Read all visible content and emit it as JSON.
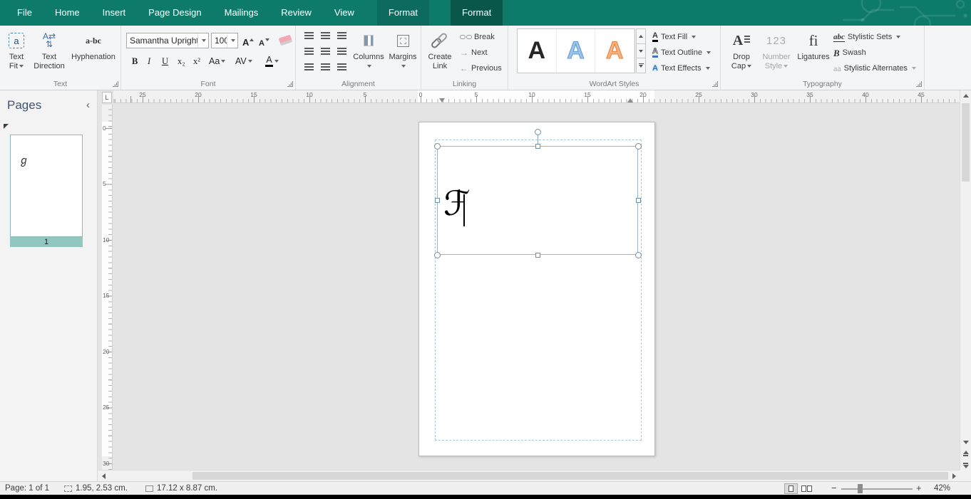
{
  "titlebar": {
    "tabs": [
      {
        "label": "File"
      },
      {
        "label": "Home"
      },
      {
        "label": "Insert"
      },
      {
        "label": "Page Design"
      },
      {
        "label": "Mailings"
      },
      {
        "label": "Review"
      },
      {
        "label": "View"
      },
      {
        "label": "Format"
      },
      {
        "label": "Format"
      }
    ]
  },
  "ribbon": {
    "text": {
      "group_label": "Text",
      "text_fit": "Text Fit",
      "text_fit_icon": "a",
      "text_direction": "Text Direction",
      "hyphenation": "Hyphenation",
      "hyphenation_icon": "a-bc"
    },
    "font": {
      "group_label": "Font",
      "font_name": "Samantha Upright",
      "font_size": "100",
      "grow_font": "A",
      "shrink_font": "A",
      "bold": "B",
      "italic": "I",
      "underline": "U",
      "subscript": "x₂",
      "superscript": "x²",
      "change_case": "Aa",
      "character_spacing": "AV",
      "font_color": "A"
    },
    "alignment": {
      "group_label": "Alignment",
      "columns": "Columns",
      "margins": "Margins"
    },
    "linking": {
      "group_label": "Linking",
      "create_link": "Create Link",
      "break_link": "Break",
      "next": "Next",
      "previous": "Previous"
    },
    "wordart": {
      "group_label": "WordArt Styles",
      "gallery": [
        "A",
        "A",
        "A"
      ],
      "text_fill": "Text Fill",
      "text_outline": "Text Outline",
      "text_effects": "Text Effects"
    },
    "typography": {
      "group_label": "Typography",
      "drop_cap": "Drop Cap",
      "number_style": "Number Style",
      "number_style_icon": "123",
      "ligatures": "Ligatures",
      "ligatures_icon": "fi",
      "stylistic_sets": "Stylistic Sets",
      "stylistic_sets_icon": "abc",
      "swash": "Swash",
      "swash_icon": "B",
      "stylistic_alternates": "Stylistic Alternates",
      "stylistic_alternates_icon": "aa"
    }
  },
  "pages_panel": {
    "title": "Pages",
    "thumbnail_glyph": "ℊ",
    "page_number": "1"
  },
  "rulers": {
    "tab_selector": "L",
    "horizontal": [
      "25",
      "20",
      "15",
      "10",
      "5",
      "0",
      "5",
      "10",
      "15",
      "20",
      "25",
      "30",
      "35",
      "40",
      "45"
    ],
    "vertical": [
      "0",
      "5",
      "10",
      "15",
      "20",
      "25",
      "30"
    ]
  },
  "canvas": {
    "textbox_glyph": "ℱ"
  },
  "statusbar": {
    "page_info": "Page: 1 of 1",
    "position": "1.95, 2.53 cm.",
    "dimensions": "17.12 x  8.87 cm.",
    "zoom_out": "−",
    "zoom_in": "+",
    "zoom_level": "42%"
  },
  "colors": {
    "accent_teal": "#0E7B6A",
    "active_tab_teal": "#09574B",
    "wordart_black": "#262626",
    "wordart_blue": "#9DC3E6",
    "wordart_orange": "#F4B183",
    "page_number_highlight": "#92C7C0",
    "guide_blue": "#A8C7E0"
  }
}
